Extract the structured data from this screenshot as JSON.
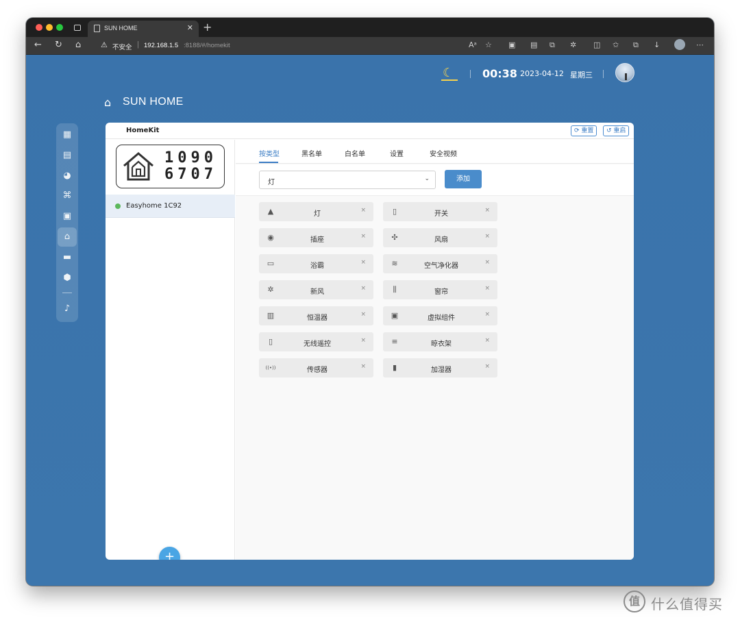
{
  "browser": {
    "tab_title": "SUN HOME",
    "insecure_label": "不安全",
    "address_host": "192.168.1.5",
    "address_path": ":8188/#/homekit"
  },
  "header": {
    "time": "00:38",
    "date": "2023-04-12",
    "weekday": "星期三",
    "brand": "SUN HOME"
  },
  "sidebar": {
    "items": [
      {
        "name": "dashboard-icon",
        "glyph": "▦"
      },
      {
        "name": "table-icon",
        "glyph": "▤"
      },
      {
        "name": "chart-icon",
        "glyph": "◕"
      },
      {
        "name": "satellite-icon",
        "glyph": "⌘"
      },
      {
        "name": "image-icon",
        "glyph": "▣"
      },
      {
        "name": "homekit-icon",
        "glyph": "⌂",
        "active": true
      },
      {
        "name": "folder-icon",
        "glyph": "▬"
      },
      {
        "name": "hexagon-icon",
        "glyph": "⬢"
      },
      {
        "name": "bell-icon",
        "glyph": "♪"
      }
    ]
  },
  "card": {
    "title": "HomeKit",
    "reset_label": "重置",
    "restart_label": "重启",
    "pair_code_line1": "1090",
    "pair_code_line2": "6707",
    "device": {
      "name": "Easyhome 1C92",
      "status_color": "#5cb85c"
    },
    "fab_label": "+"
  },
  "tabs": [
    {
      "label": "按类型",
      "active": true
    },
    {
      "label": "黑名单"
    },
    {
      "label": "白名单"
    },
    {
      "label": "设置"
    },
    {
      "label": "安全视频"
    }
  ],
  "filter": {
    "selected": "灯",
    "add_label": "添加"
  },
  "accessories": [
    {
      "label": "灯",
      "icon": "lamp-icon",
      "glyph": "▲"
    },
    {
      "label": "开关",
      "icon": "switch-icon",
      "glyph": "▯"
    },
    {
      "label": "插座",
      "icon": "outlet-icon",
      "glyph": "◉"
    },
    {
      "label": "风扇",
      "icon": "fan-icon",
      "glyph": "✣"
    },
    {
      "label": "浴霸",
      "icon": "bath-heater-icon",
      "glyph": "▭"
    },
    {
      "label": "空气净化器",
      "icon": "air-purifier-icon",
      "glyph": "≋"
    },
    {
      "label": "新风",
      "icon": "fresh-air-icon",
      "glyph": "✲"
    },
    {
      "label": "窗帘",
      "icon": "curtain-icon",
      "glyph": "⫼"
    },
    {
      "label": "恒温器",
      "icon": "thermostat-icon",
      "glyph": "▥"
    },
    {
      "label": "虚拟组件",
      "icon": "virtual-component-icon",
      "glyph": "▣"
    },
    {
      "label": "无线遥控",
      "icon": "remote-icon",
      "glyph": "▯"
    },
    {
      "label": "晾衣架",
      "icon": "clothes-rack-icon",
      "glyph": "≡"
    },
    {
      "label": "传感器",
      "icon": "sensor-icon",
      "glyph": "((•))"
    },
    {
      "label": "加湿器",
      "icon": "humidifier-icon",
      "glyph": "▮"
    }
  ],
  "remove_glyph": "×",
  "watermark": {
    "logo": "值",
    "text": "什么值得买"
  },
  "colors": {
    "accent": "#3a7cc4",
    "page_bg": "#3b74ab",
    "online": "#5cb85c",
    "add_button": "#4a8ccb"
  }
}
